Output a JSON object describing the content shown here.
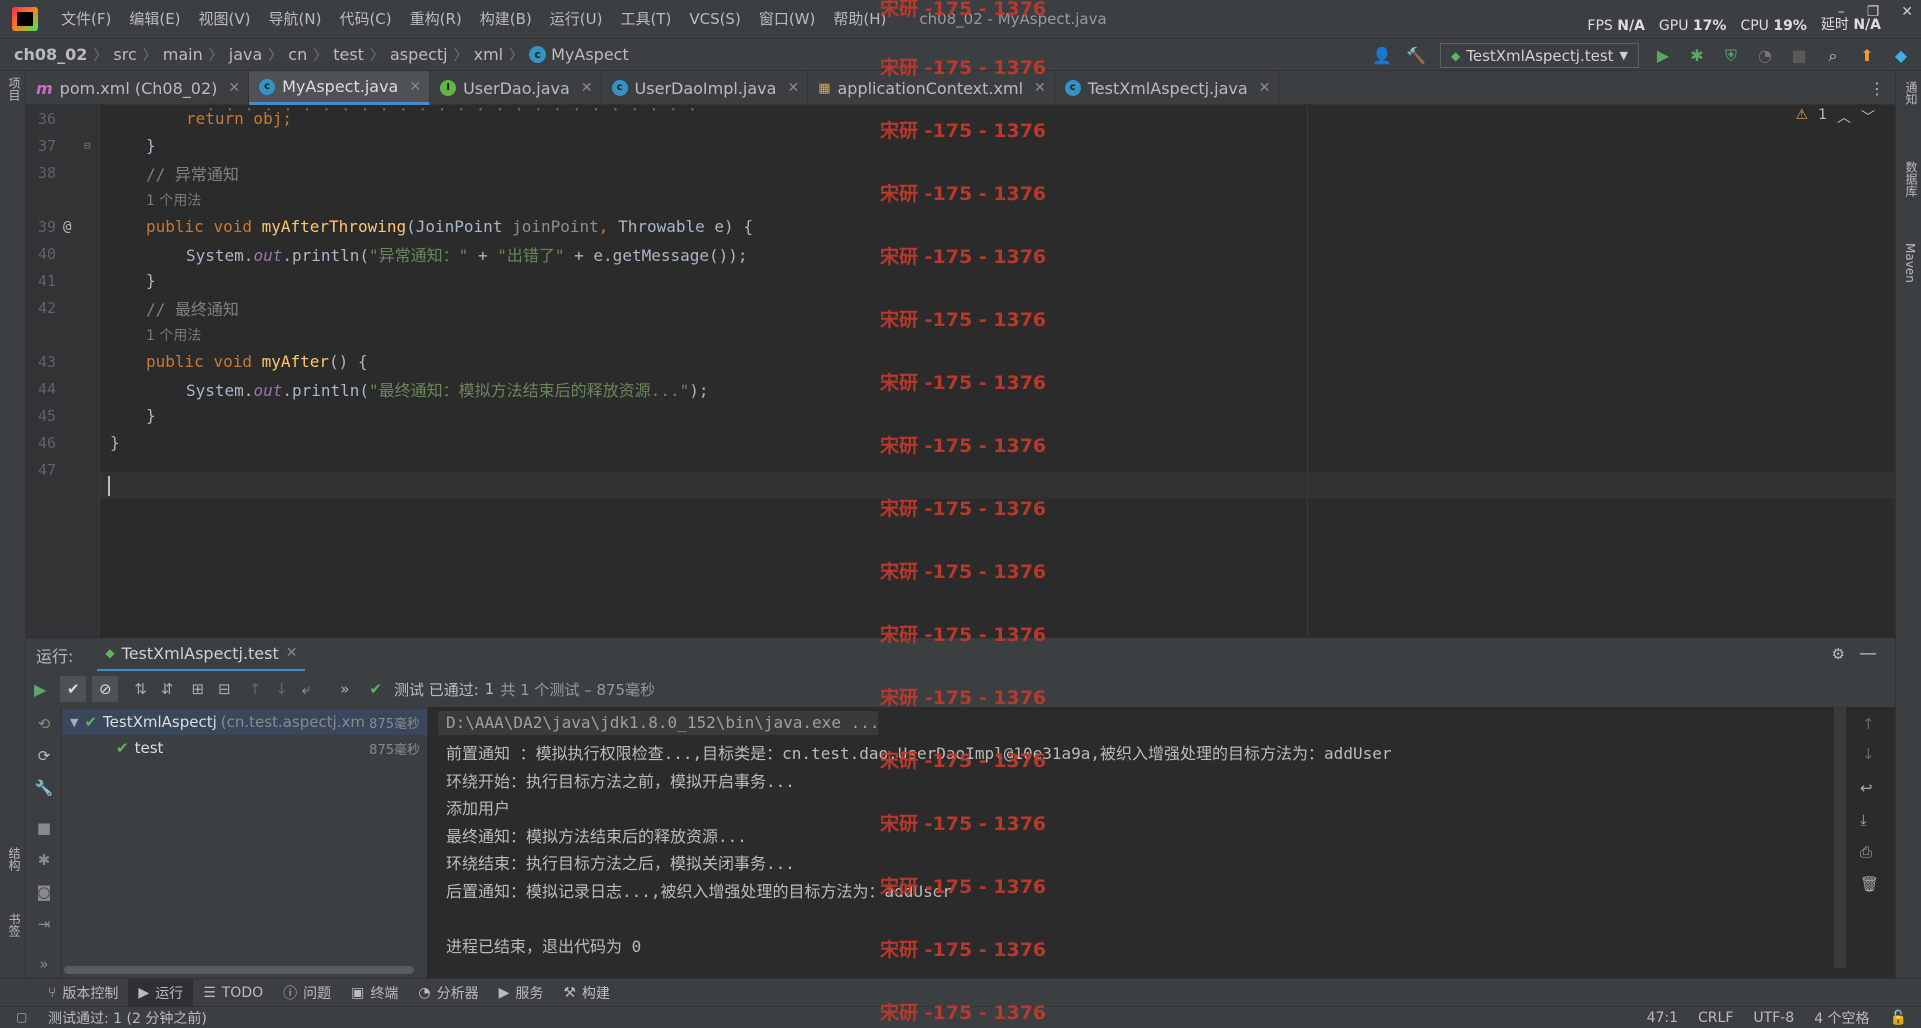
{
  "menubar": {
    "items": [
      "文件(F)",
      "编辑(E)",
      "视图(V)",
      "导航(N)",
      "代码(C)",
      "重构(R)",
      "构建(B)",
      "运行(U)",
      "工具(T)",
      "VCS(S)",
      "窗口(W)",
      "帮助(H)"
    ],
    "window_title": "ch08_02 - MyAspect.java",
    "perf": {
      "fps_label": "FPS",
      "fps": "N/A",
      "gpu_label": "GPU",
      "gpu": "17%",
      "cpu_label": "CPU",
      "cpu": "19%",
      "latency_label": "延时",
      "latency": "N/A"
    }
  },
  "breadcrumb": [
    "ch08_02",
    "src",
    "main",
    "java",
    "cn",
    "test",
    "aspectj",
    "xml",
    "MyAspect"
  ],
  "run_config": {
    "label": "TestXmlAspectj.test"
  },
  "left_strip": {
    "project_label": "项目",
    "structure_label": "结构",
    "bookmarks_label": "书签"
  },
  "right_strip": {
    "notifications_label": "通知",
    "database_label": "数据库",
    "maven_label": "Maven"
  },
  "tabs": [
    {
      "label": "pom.xml (Ch08_02)",
      "icon": "maven-icon",
      "active": false
    },
    {
      "label": "MyAspect.java",
      "icon": "class-icon",
      "active": true
    },
    {
      "label": "UserDao.java",
      "icon": "interface-icon",
      "active": false
    },
    {
      "label": "UserDaoImpl.java",
      "icon": "class-icon",
      "active": false
    },
    {
      "label": "applicationContext.xml",
      "icon": "spring-xml-icon",
      "active": false
    },
    {
      "label": "TestXmlAspectj.java",
      "icon": "class-icon",
      "active": false
    }
  ],
  "editor": {
    "warning_count": "1",
    "lines": {
      "l36": {
        "num": "36",
        "text": "return obj;"
      },
      "l37": {
        "num": "37",
        "text": "}"
      },
      "l38": {
        "num": "38",
        "text": "// 异常通知"
      },
      "hint1": "1 个用法",
      "l39": {
        "num": "39"
      },
      "l40": {
        "num": "40"
      },
      "l41": {
        "num": "41",
        "text": "}"
      },
      "l42": {
        "num": "42",
        "text": "// 最终通知"
      },
      "hint2": "1 个用法",
      "l43": {
        "num": "43"
      },
      "l44": {
        "num": "44"
      },
      "l45": {
        "num": "45",
        "text": "}"
      },
      "l46": {
        "num": "46",
        "text": "}"
      },
      "l47": {
        "num": "47"
      }
    },
    "tokens": {
      "public": "public",
      "void": "void",
      "afterThrowing": "myAfterThrowing",
      "joinPointType": "JoinPoint",
      "joinPointParam": "joinPoint",
      "throwable": "Throwable e",
      "sysout": "System.",
      "out": "out",
      "println": ".println(",
      "str_exc1": "\"异常通知：\"",
      "plus": " + ",
      "str_exc2": "\"出错了\"",
      "getmsg": " + e.getMessage());",
      "after": "myAfter",
      "after_args": "() {",
      "str_final": "\"最终通知：模拟方法结束后的释放资源...\"",
      "close": ");",
      "brace_open": ") {"
    }
  },
  "run_panel": {
    "title": "运行:",
    "tab_label": "TestXmlAspectj.test",
    "status_prefix": "测试 已通过:",
    "status_count": "1",
    "status_suffix": "共 1 个测试 – 875毫秒",
    "tree": [
      {
        "label": "TestXmlAspectj",
        "detail": "(cn.test.aspectj.xm",
        "time": "875毫秒"
      },
      {
        "label": "test",
        "time": "875毫秒"
      }
    ],
    "console": [
      "D:\\AAA\\DA2\\java\\jdk1.8.0_152\\bin\\java.exe ...",
      "前置通知 ：模拟执行权限检查...,目标类是：cn.test.dao.UserDaoImpl@10e31a9a,被织入增强处理的目标方法为：addUser",
      "环绕开始：执行目标方法之前，模拟开启事务...",
      "添加用户",
      "最终通知：模拟方法结束后的释放资源...",
      "环绕结束：执行目标方法之后，模拟关闭事务...",
      "后置通知：模拟记录日志...,被织入增强处理的目标方法为：addUser",
      "",
      "进程已结束，退出代码为 0"
    ]
  },
  "toolwindows": [
    "版本控制",
    "运行",
    "TODO",
    "问题",
    "终端",
    "分析器",
    "服务",
    "构建"
  ],
  "statusbar": {
    "message": "测试通过: 1 (2 分钟之前)",
    "position": "47:1",
    "line_sep": "CRLF",
    "encoding": "UTF-8",
    "indent": "4 个空格"
  },
  "watermark": "宋研 -175 - 1376",
  "colors": {
    "accent": "#4a88c7",
    "pass": "#5fb55f",
    "watermark": "#c0392b"
  }
}
